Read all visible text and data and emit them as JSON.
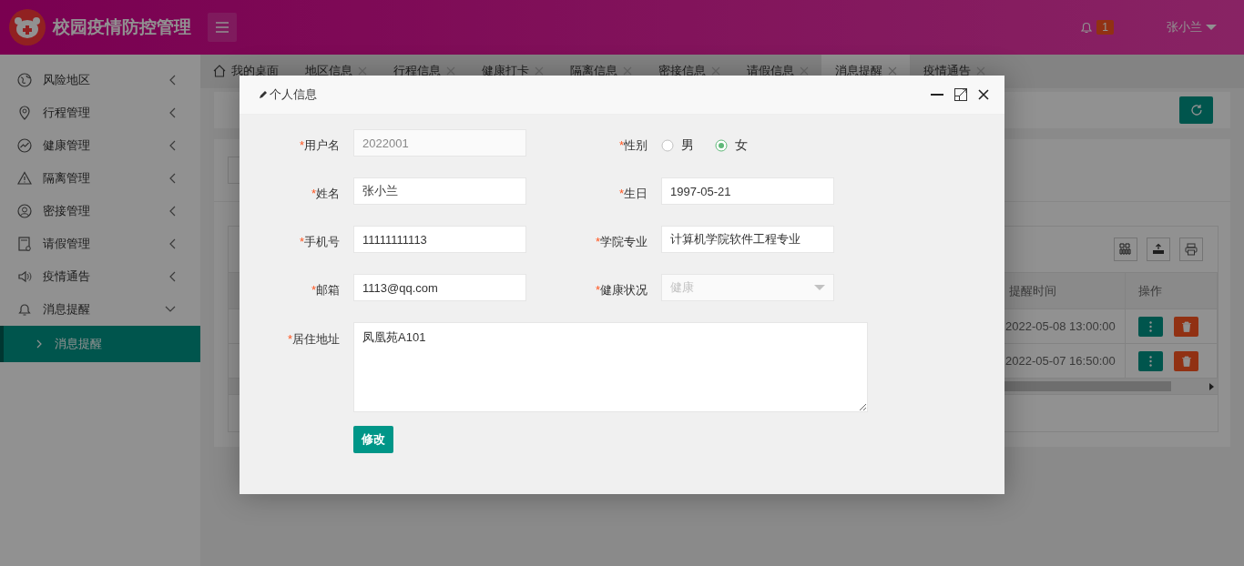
{
  "header": {
    "title": "校园疫情防控管理",
    "notification_count": "1",
    "user": "张小兰"
  },
  "sidebar": {
    "items": [
      {
        "label": "风险地区",
        "expanded": false
      },
      {
        "label": "行程管理",
        "expanded": false
      },
      {
        "label": "健康管理",
        "expanded": false
      },
      {
        "label": "隔离管理",
        "expanded": false
      },
      {
        "label": "密接管理",
        "expanded": false
      },
      {
        "label": "请假管理",
        "expanded": false
      },
      {
        "label": "疫情通告",
        "expanded": false
      },
      {
        "label": "消息提醒",
        "expanded": true,
        "children": [
          {
            "label": "消息提醒",
            "selected": true
          }
        ]
      }
    ]
  },
  "tabs": [
    {
      "label": "我的桌面",
      "kind": "home",
      "selected": false
    },
    {
      "label": "地区信息",
      "kind": "page",
      "selected": false
    },
    {
      "label": "行程信息",
      "kind": "page",
      "selected": false
    },
    {
      "label": "健康打卡",
      "kind": "page",
      "selected": false
    },
    {
      "label": "隔离信息",
      "kind": "page",
      "selected": false
    },
    {
      "label": "密接信息",
      "kind": "page",
      "selected": false
    },
    {
      "label": "请假信息",
      "kind": "page",
      "selected": false
    },
    {
      "label": "消息提醒",
      "kind": "page",
      "selected": true
    },
    {
      "label": "疫情通告",
      "kind": "page",
      "selected": false
    }
  ],
  "table": {
    "columns": [
      {
        "label": "提醒时间"
      },
      {
        "label": "操作"
      }
    ],
    "rows": [
      {
        "cells": [
          "2022-05-08 13:00:00"
        ]
      },
      {
        "cells": [
          "2022-05-07 16:50:00"
        ]
      }
    ]
  },
  "dialog": {
    "title": "个人信息",
    "fields": [
      {
        "kind": "text",
        "label": "用户名",
        "required_mark": "*",
        "value": "2022001",
        "disabled": true
      },
      {
        "kind": "radio",
        "label": "性别",
        "required_mark": "*",
        "options": [
          {
            "label": "男",
            "selected": false
          },
          {
            "label": "女",
            "selected": true
          }
        ]
      },
      {
        "kind": "text",
        "label": "姓名",
        "required_mark": "*",
        "value": "张小兰",
        "disabled": false
      },
      {
        "kind": "text",
        "label": "生日",
        "required_mark": "*",
        "value": "1997-05-21",
        "disabled": false
      },
      {
        "kind": "text",
        "label": "手机号",
        "required_mark": "*",
        "value": "11111111113",
        "disabled": false
      },
      {
        "kind": "text",
        "label": "学院专业",
        "required_mark": "*",
        "value": "计算机学院软件工程专业",
        "disabled": false
      },
      {
        "kind": "text",
        "label": "邮箱",
        "required_mark": "*",
        "value": "1113@qq.com",
        "disabled": false
      },
      {
        "kind": "select",
        "label": "健康状况",
        "required_mark": "*",
        "value": "健康",
        "disabled": true
      },
      {
        "kind": "textarea",
        "label": "居住地址",
        "required_mark": "*",
        "value": "凤凰苑A101",
        "disabled": false
      }
    ],
    "submit": "修改"
  }
}
